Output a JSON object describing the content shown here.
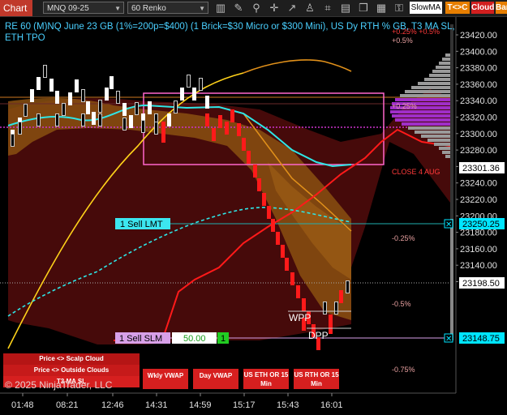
{
  "toolbar": {
    "tab_label": "Chart",
    "instrument": "MNQ 09-25",
    "bar_type": "60 Renko",
    "indicator": "SlowMA",
    "tc_label": "T<>C",
    "cloud_label": "Cloud",
    "bar_label": "Bar"
  },
  "title": "RE 60 (M)NQ June 23 GB (1%=200p=$400) (1 Brick=$30 Micro or $300 Mini), US Dy RTH % GB, T3 MA SL, ETH TPO",
  "copyright": "© 2025 NinjaTrader, LLC",
  "price_axis": {
    "ticks": [
      "23420.00",
      "23400.00",
      "23380.00",
      "23360.00",
      "23340.00",
      "23320.00",
      "23300.00",
      "23280.00",
      "23260.00",
      "23240.00",
      "23220.00",
      "23200.00",
      "23180.00",
      "23160.00",
      "23140.00",
      "23120.00"
    ],
    "tags": {
      "close_tag": "23301.36",
      "sell_lmt_tag": "23250.25",
      "last_price_tag": "23198.50",
      "sell_slm_tag": "23148.75"
    }
  },
  "time_axis": [
    "01:48",
    "08:21",
    "12:46",
    "14:31",
    "14:59",
    "15:17",
    "15:43",
    "16:01"
  ],
  "pct_labels": {
    "p05": "+0.5%",
    "p025": "+0.25%",
    "m025": "-0.25%",
    "m05": "-0.5%",
    "m075": "-0.75%",
    "top_overlay": "+0.25% +0.5%"
  },
  "annotations": {
    "close_label": "CLOSE 4 AUG",
    "wpp": "WPP",
    "dpp": "DPP"
  },
  "orders": {
    "sell_lmt": "1 Sell LMT",
    "sell_slm": "1 Sell SLM",
    "slm_value": "50.00",
    "slm_qty": "1",
    "close_x": "✕"
  },
  "footer": {
    "scalp_cloud": "Price <> Scalp Cloud",
    "outside_clouds": "Price <> Outside Clouds",
    "t3_ma_sl": "T3 MA SL",
    "wkly_vwap": "Wkly VWAP",
    "day_vwap": "Day VWAP",
    "us_eth_or": "US ETH OR 15 Min",
    "us_rth_or": "US RTH OR 15 Min"
  },
  "colors": {
    "up_brick": "#ffffff",
    "down_brick": "#ff1a1a",
    "cloud_orange": "#b8701a",
    "cloud_red": "#5a0d0d",
    "cyan_ma": "#2ee6e6",
    "yellow_ma": "#ffd21a",
    "magenta": "#cc33cc",
    "pink_box": "#ff66cc",
    "tag_cyan": "#00e5ff",
    "tag_white": "#ffffff",
    "slm_purple": "#d8a0e8"
  }
}
